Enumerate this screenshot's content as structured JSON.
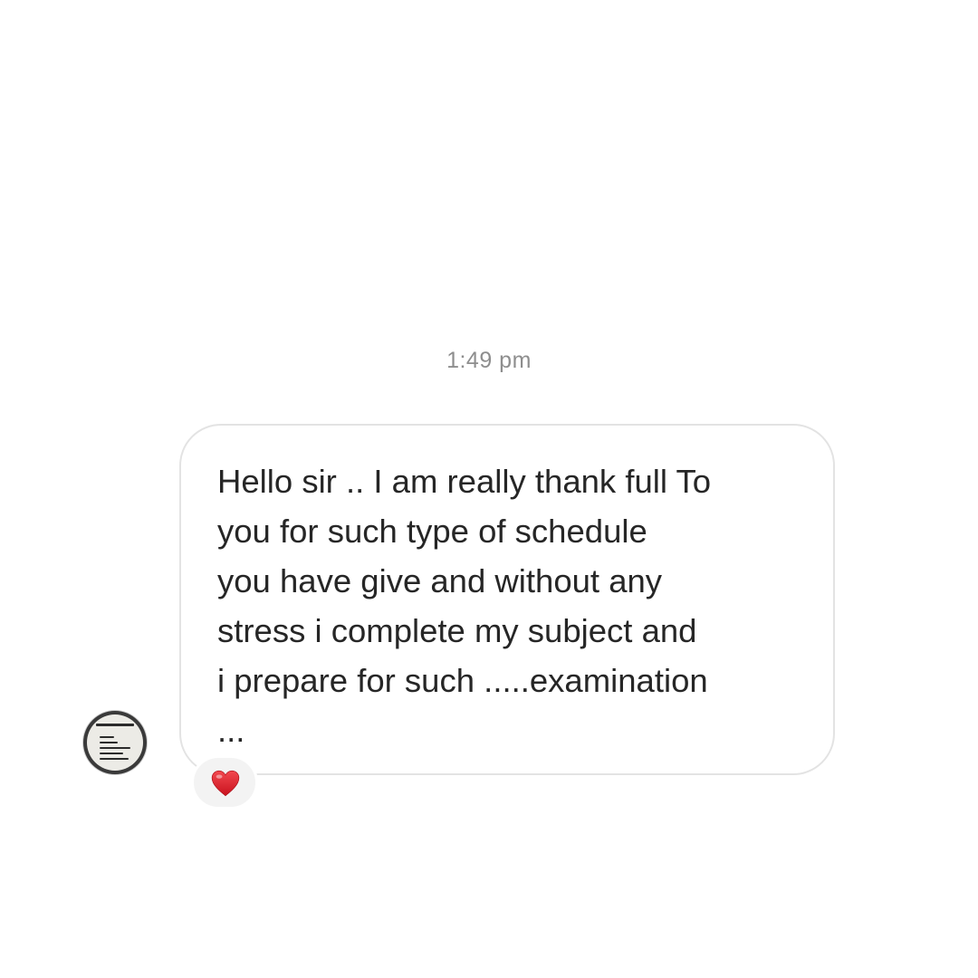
{
  "conversation": {
    "timestamp": "1:49 pm",
    "message": {
      "lines": [
        "Hello sir .. I am really thank full To",
        "you for such type of schedule",
        "you have give and without any",
        "stress i complete my subject and",
        "i prepare for such .....examination",
        "..."
      ],
      "reaction_icon": "red-heart-icon",
      "reaction_color": "#e0212f"
    },
    "sender": {
      "avatar_icon": "profile-picture-avatar"
    }
  }
}
